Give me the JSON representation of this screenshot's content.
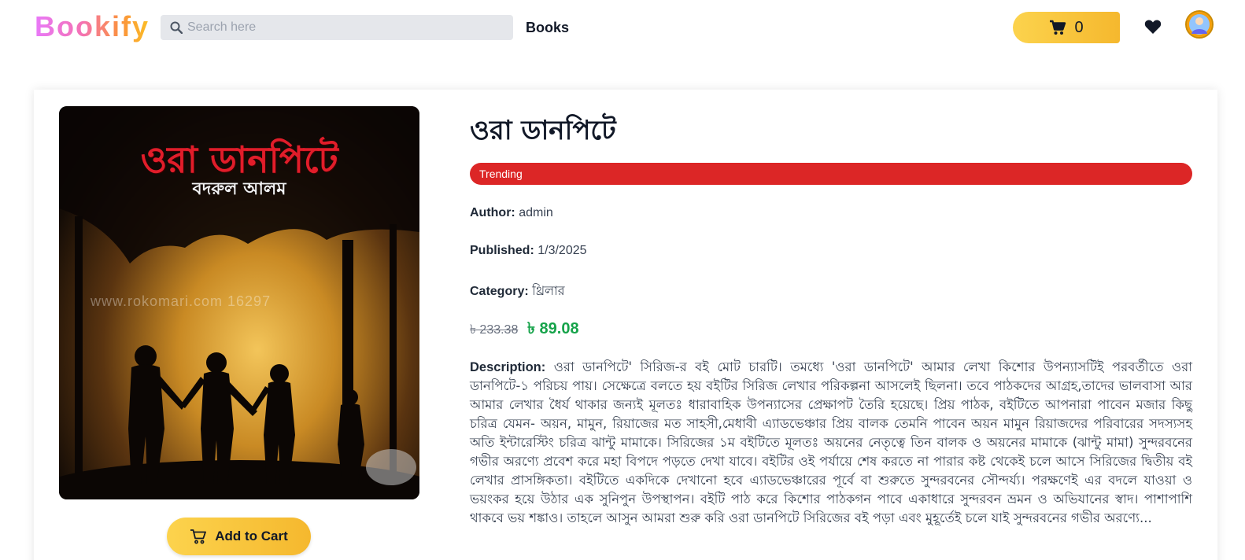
{
  "brand": {
    "logo": "Bookify"
  },
  "nav": {
    "search_placeholder": "Search here",
    "books_label": "Books",
    "cart_count": "0"
  },
  "book": {
    "cover_title": "ওরা ডানপিটে",
    "cover_author": "বদরুল আলম",
    "cover_watermark": "www.rokomari.com  16297",
    "title": "ওরা ডানপিটে",
    "badge": "Trending",
    "author_label": "Author:",
    "author": "admin",
    "published_label": "Published:",
    "published": "1/3/2025",
    "category_label": "Category:",
    "category": "থ্রিলার",
    "price_old": "৳ 233.38",
    "price_new": "৳ 89.08",
    "description_label": "Description:",
    "description": "ওরা ডানপিটে' সিরিজ-র বই মোট চারটি। তমধ্যে 'ওরা ডানপিটে' আমার লেখা কিশোর উপন্যাসটিই পরবর্তীতে ওরা ডানপিটে-১ পরিচয় পায়। সেক্ষেত্রে বলতে হয় বইটির সিরিজ লেখার পরিকল্পনা আসলেই ছিলনা। তবে পাঠকদের আগ্রহ,তাদের ভালবাসা আর আমার লেখার ধৈর্য থাকার জন্যই মূলতঃ ধারাবাহিক উপন্যাসের প্রেক্ষাপট তৈরি হয়েছে। প্রিয় পাঠক, বইটিতে আপনারা পাবেন মজার কিছু চরিত্র যেমন- অয়ন, মামুন, রিয়াজের মত সাহসী,মেধাবী এ্যাডভেঞ্চার প্রিয় বালক তেমনি পাবেন অয়ন মামুন রিয়াজদের পরিবারের সদস্যসহ অতি ইন্টারেস্টিং চরিত্র ঝান্টু মামাকে। সিরিজের ১ম বইটিতে মূলতঃ অয়নের নেতৃত্বে তিন বালক ও অয়নের মামাকে (ঝান্টু মামা) সুন্দরবনের গভীর অরণ্যে প্রবেশ করে মহা বিপদে পড়তে দেখা যাবে। বইটির ওই পর্যায়ে শেষ করতে না পারার কষ্ট থেকেই চলে আসে সিরিজের দ্বিতীয় বই লেখার প্রাসঙ্গিকতা। বইটিতে একদিকে দেখানো হবে এ্যাডভেঞ্চারের পূর্বে বা শুরুতে সুন্দরবনের সৌন্দর্য্য। পরক্ষণেই এর বদলে যাওয়া ও ভয়ংকর হয়ে উঠার এক সুনিপুন উপস্থাপন। বইটি পাঠ করে কিশোর পাঠকগন পাবে একাধারে সুন্দরবন ভ্রমন ও অভিযানের স্বাদ। পাশাপাশি থাকবে ভয় শঙ্কাও। তাহলে আসুন আমরা শুরু করি ওরা ডানপিটে সিরিজের বই পড়া এবং মুহূর্তেই চলে যাই সুন্দরবনের গভীর অরণ্যে...",
    "add_to_cart": "Add to Cart"
  },
  "colors": {
    "accent": "#fbbf24",
    "badge": "#dc2626",
    "price_new": "#16a34a"
  },
  "icons": [
    "search-icon",
    "cart-icon",
    "heart-icon",
    "avatar",
    "cart-outline-icon"
  ]
}
